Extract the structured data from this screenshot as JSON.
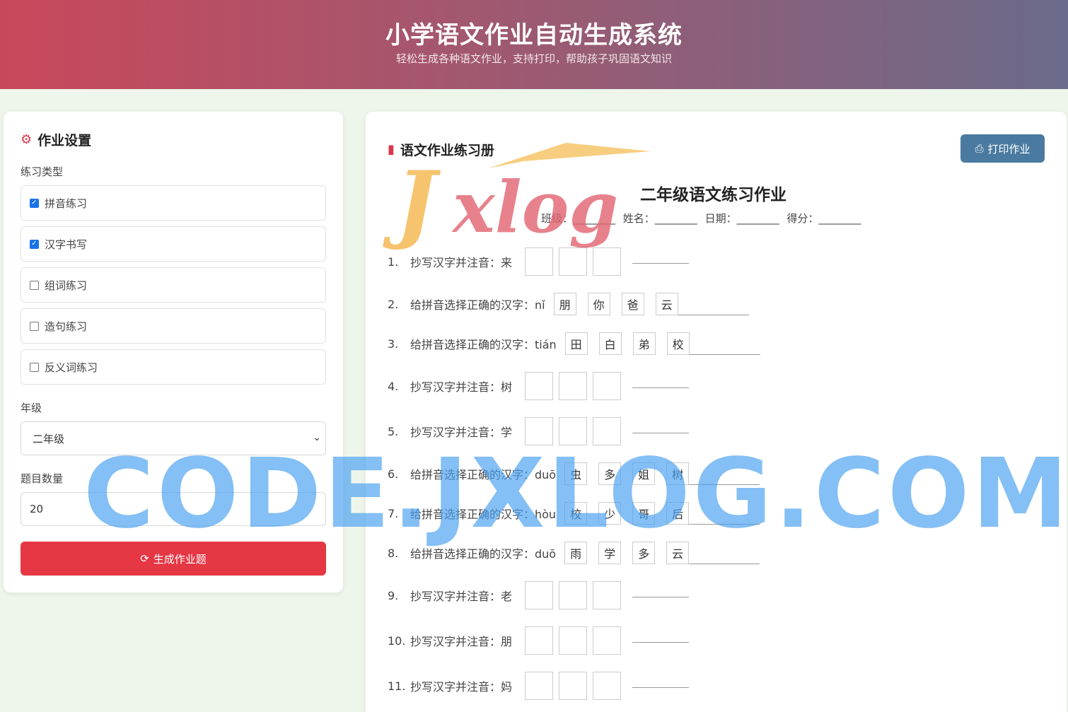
{
  "header": {
    "title": "小学语文作业自动生成系统",
    "subtitle": "轻松生成各种语文作业，支持打印，帮助孩子巩固语文知识"
  },
  "settings": {
    "title": "作业设置",
    "type_label": "练习类型",
    "types": [
      {
        "label": "拼音练习",
        "checked": true
      },
      {
        "label": "汉字书写",
        "checked": true
      },
      {
        "label": "组词练习",
        "checked": false
      },
      {
        "label": "造句练习",
        "checked": false
      },
      {
        "label": "反义词练习",
        "checked": false
      }
    ],
    "grade_label": "年级",
    "grade_value": "二年级",
    "count_label": "题目数量",
    "count_value": "20",
    "generate_label": "生成作业题"
  },
  "worksheet": {
    "panel_title": "语文作业练习册",
    "print_label": "打印作业",
    "title": "二年级语文练习作业",
    "info": [
      "班级：________",
      "姓名：________",
      "日期：________",
      "得分：________"
    ],
    "questions": [
      {
        "num": "1.",
        "text": "抄写汉字并注音：来",
        "kind": "copy"
      },
      {
        "num": "2.",
        "text": "给拼音选择正确的汉字：nǐ",
        "kind": "choose",
        "options": [
          "朋",
          "你",
          "爸",
          "云"
        ]
      },
      {
        "num": "3.",
        "text": "给拼音选择正确的汉字：tián",
        "kind": "choose",
        "options": [
          "田",
          "白",
          "弟",
          "校"
        ]
      },
      {
        "num": "4.",
        "text": "抄写汉字并注音：树",
        "kind": "copy"
      },
      {
        "num": "5.",
        "text": "抄写汉字并注音：学",
        "kind": "copy"
      },
      {
        "num": "6.",
        "text": "给拼音选择正确的汉字：duō",
        "kind": "choose",
        "options": [
          "虫",
          "多",
          "姐",
          "树"
        ]
      },
      {
        "num": "7.",
        "text": "给拼音选择正确的汉字：hòu",
        "kind": "choose",
        "options": [
          "校",
          "少",
          "哥",
          "后"
        ]
      },
      {
        "num": "8.",
        "text": "给拼音选择正确的汉字：duō",
        "kind": "choose",
        "options": [
          "雨",
          "学",
          "多",
          "云"
        ]
      },
      {
        "num": "9.",
        "text": "抄写汉字并注音：老",
        "kind": "copy"
      },
      {
        "num": "10.",
        "text": "抄写汉字并注音：朋",
        "kind": "copy"
      },
      {
        "num": "11.",
        "text": "抄写汉字并注音：妈",
        "kind": "copy"
      }
    ]
  },
  "watermarks": {
    "logo": "Jxlog",
    "site": "CODE.JXLOG.COM"
  }
}
